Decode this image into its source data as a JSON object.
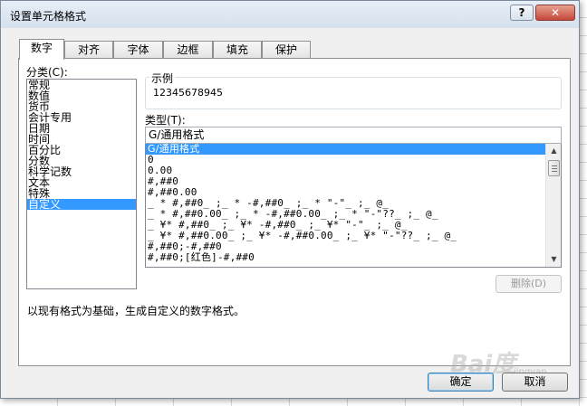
{
  "window": {
    "title": "设置单元格格式",
    "help_label": "?",
    "close_label": "✕"
  },
  "tabs": [
    {
      "label": "数字"
    },
    {
      "label": "对齐"
    },
    {
      "label": "字体"
    },
    {
      "label": "边框"
    },
    {
      "label": "填充"
    },
    {
      "label": "保护"
    }
  ],
  "category": {
    "label": "分类(C):",
    "items": [
      "常规",
      "数值",
      "货币",
      "会计专用",
      "日期",
      "时间",
      "百分比",
      "分数",
      "科学记数",
      "文本",
      "特殊",
      "自定义"
    ],
    "selected": "自定义"
  },
  "sample": {
    "legend": "示例",
    "value": "12345678945"
  },
  "type": {
    "label": "类型(T):",
    "input_value": "G/通用格式",
    "formats": [
      "G/通用格式",
      "0",
      "0.00",
      "#,##0",
      "#,##0.00",
      "_ * #,##0_ ;_ * -#,##0_ ;_ * \"-\"_ ;_ @_",
      "_ * #,##0.00_ ;_ * -#,##0.00_ ;_ * \"-\"??_ ;_ @_",
      "_ ¥* #,##0_ ;_ ¥* -#,##0_ ;_ ¥* \"-\"_ ;_ @_",
      "_ ¥* #,##0.00_ ;_ ¥* -#,##0.00_ ;_ ¥* \"-\"??_ ;_ @_",
      "#,##0;-#,##0",
      "#,##0;[红色]-#,##0"
    ],
    "selected": "G/通用格式"
  },
  "buttons": {
    "delete": "删除(D)",
    "ok": "确定",
    "cancel": "取消"
  },
  "description": "以现有格式为基础，生成自定义的数字格式。",
  "watermark": {
    "main": "Bai度",
    "sub": "jingyan"
  },
  "colors": {
    "selection": "#3399ff",
    "panel": "#ffffff",
    "dialog": "#f0f0f0"
  }
}
